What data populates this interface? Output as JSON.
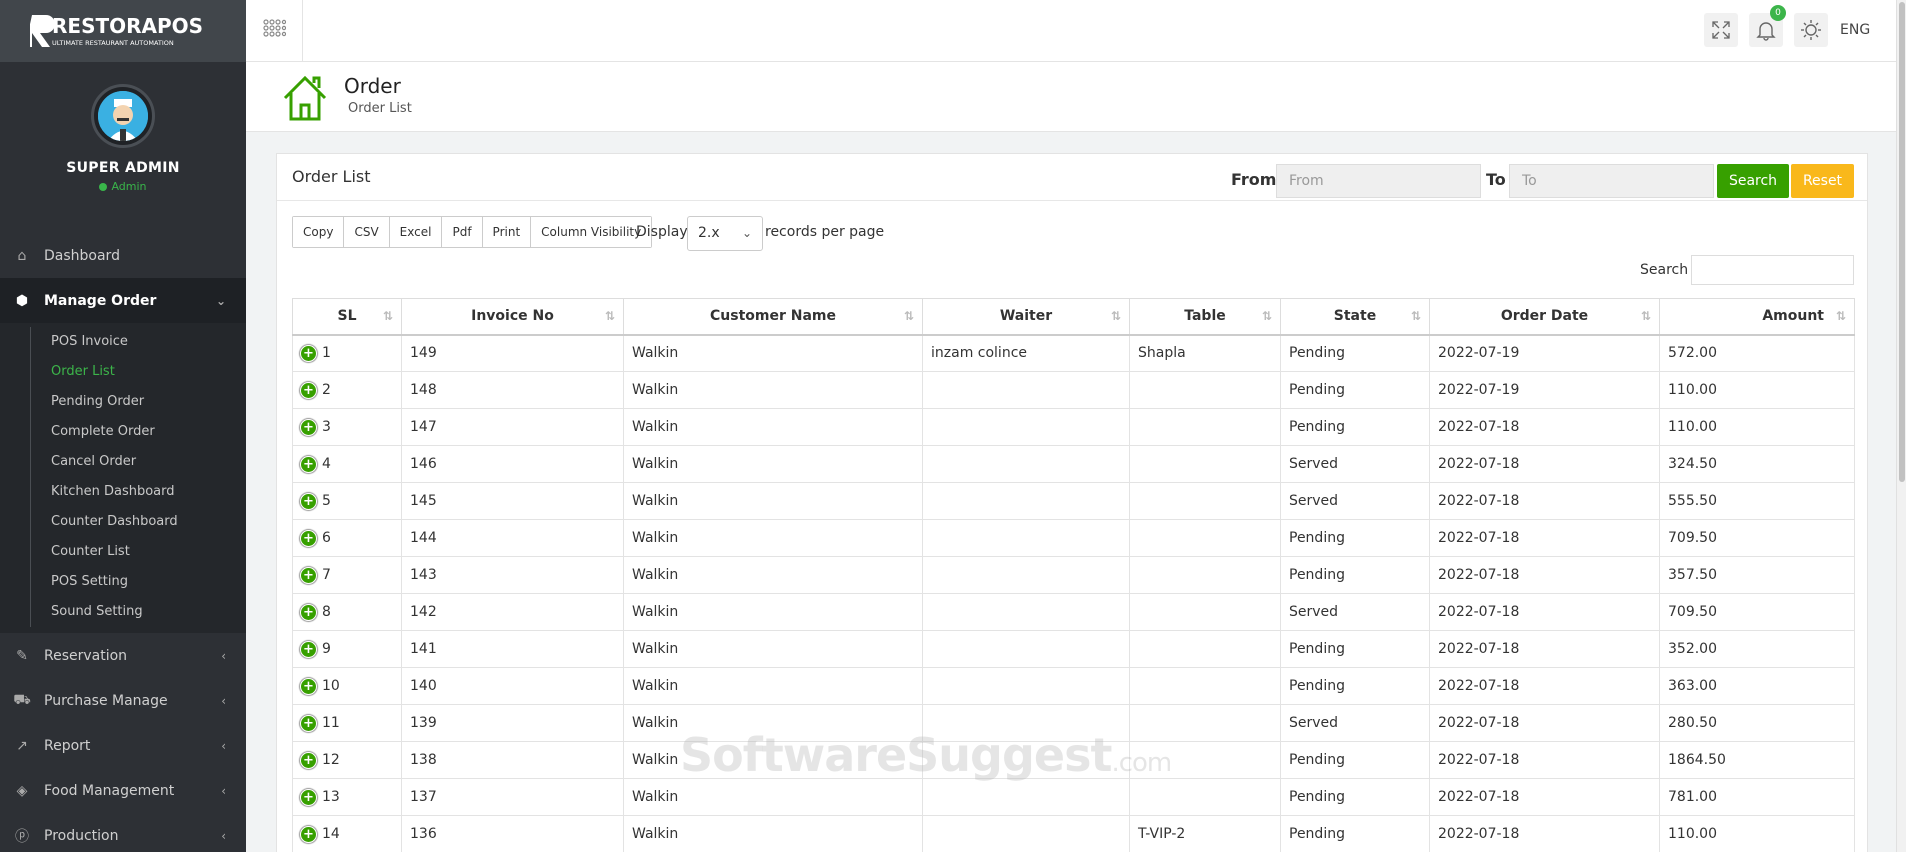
{
  "brand": {
    "name": "RESTORAPOS",
    "tagline": "ULTIMATE RESTAURANT AUTOMATION"
  },
  "profile": {
    "name": "SUPER ADMIN",
    "role": "Admin"
  },
  "nav": {
    "dashboard": "Dashboard",
    "manage_order": "Manage Order",
    "sub_items": [
      "POS Invoice",
      "Order List",
      "Pending Order",
      "Complete Order",
      "Cancel Order",
      "Kitchen Dashboard",
      "Counter Dashboard",
      "Counter List",
      "POS Setting",
      "Sound Setting"
    ],
    "reservation": "Reservation",
    "purchase_manage": "Purchase Manage",
    "report": "Report",
    "food_management": "Food Management",
    "production": "Production"
  },
  "topbar": {
    "notification_count": "0",
    "language": "ENG"
  },
  "page": {
    "title": "Order",
    "subtitle": "Order List"
  },
  "card": {
    "title": "Order List",
    "from_label": "From",
    "from_placeholder": "From",
    "to_label": "To",
    "to_placeholder": "To",
    "search_button": "Search",
    "reset_button": "Reset"
  },
  "toolbar": {
    "export_buttons": [
      "Copy",
      "CSV",
      "Excel",
      "Pdf",
      "Print",
      "Column Visibility"
    ],
    "display_label": "Display",
    "page_length": "2.x",
    "records_label": "records per page",
    "search_label": "Search"
  },
  "table": {
    "columns": [
      "SL",
      "Invoice No",
      "Customer Name",
      "Waiter",
      "Table",
      "State",
      "Order Date",
      "Amount"
    ],
    "rows": [
      [
        "1",
        "149",
        "Walkin",
        "inzam colince",
        "Shapla",
        "Pending",
        "2022-07-19",
        "572.00"
      ],
      [
        "2",
        "148",
        "Walkin",
        "",
        "",
        "Pending",
        "2022-07-19",
        "110.00"
      ],
      [
        "3",
        "147",
        "Walkin",
        "",
        "",
        "Pending",
        "2022-07-18",
        "110.00"
      ],
      [
        "4",
        "146",
        "Walkin",
        "",
        "",
        "Served",
        "2022-07-18",
        "324.50"
      ],
      [
        "5",
        "145",
        "Walkin",
        "",
        "",
        "Served",
        "2022-07-18",
        "555.50"
      ],
      [
        "6",
        "144",
        "Walkin",
        "",
        "",
        "Pending",
        "2022-07-18",
        "709.50"
      ],
      [
        "7",
        "143",
        "Walkin",
        "",
        "",
        "Pending",
        "2022-07-18",
        "357.50"
      ],
      [
        "8",
        "142",
        "Walkin",
        "",
        "",
        "Served",
        "2022-07-18",
        "709.50"
      ],
      [
        "9",
        "141",
        "Walkin",
        "",
        "",
        "Pending",
        "2022-07-18",
        "352.00"
      ],
      [
        "10",
        "140",
        "Walkin",
        "",
        "",
        "Pending",
        "2022-07-18",
        "363.00"
      ],
      [
        "11",
        "139",
        "Walkin",
        "",
        "",
        "Served",
        "2022-07-18",
        "280.50"
      ],
      [
        "12",
        "138",
        "Walkin",
        "",
        "",
        "Pending",
        "2022-07-18",
        "1864.50"
      ],
      [
        "13",
        "137",
        "Walkin",
        "",
        "",
        "Pending",
        "2022-07-18",
        "781.00"
      ],
      [
        "14",
        "136",
        "Walkin",
        "",
        "T-VIP-2",
        "Pending",
        "2022-07-18",
        "110.00"
      ]
    ]
  },
  "watermark": {
    "main": "SoftwareSuggest",
    "suffix": ".com"
  },
  "colors": {
    "accent_green": "#37a000",
    "reset_yellow": "#f9b81b",
    "sidebar_bg": "#2d3035"
  }
}
